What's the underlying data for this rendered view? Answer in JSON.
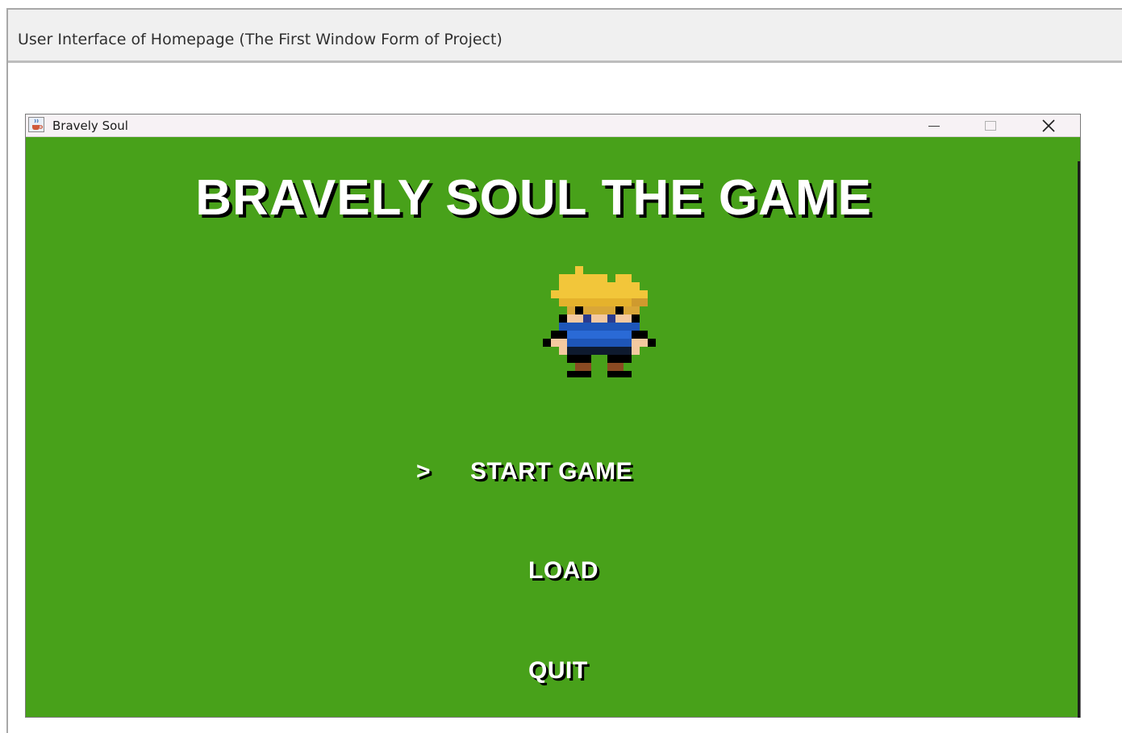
{
  "caption": "User Interface of Homepage (The First Window Form of Project)",
  "window": {
    "title": "Bravely Soul",
    "icon": "java-cup-icon",
    "controls": {
      "minimize_icon": "minimize-icon",
      "maximize_icon": "maximize-icon",
      "close_icon": "close-icon"
    }
  },
  "game": {
    "title": "BRAVELY SOUL THE GAME",
    "hero": "hero-sprite",
    "menu": {
      "cursor": ">",
      "items": [
        "START GAME",
        "LOAD",
        "QUIT"
      ],
      "selected": "START GAME"
    }
  },
  "colors": {
    "background": "#48a11a",
    "text": "#ffffff",
    "text_shadow": "#000000",
    "hair": "#f2c63a",
    "shirt": "#1e56b8"
  }
}
